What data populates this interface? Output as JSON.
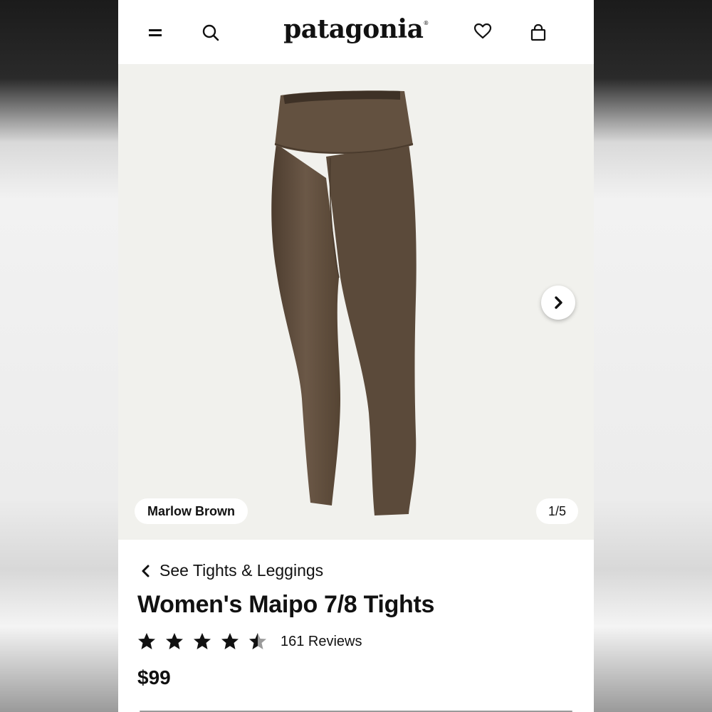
{
  "header": {
    "logo": "patagonia",
    "logo_mark": "®",
    "icons": [
      "menu-icon",
      "search-icon",
      "heart-icon",
      "bag-icon"
    ]
  },
  "gallery": {
    "color_name": "Marlow Brown",
    "counter": "1/5",
    "product_color": "#5b4a3a"
  },
  "product": {
    "back_link": "See Tights & Leggings",
    "title": "Women's Maipo 7/8 Tights",
    "rating": 4.5,
    "rating_max": 5,
    "reviews": "161 Reviews",
    "price": "$99"
  }
}
